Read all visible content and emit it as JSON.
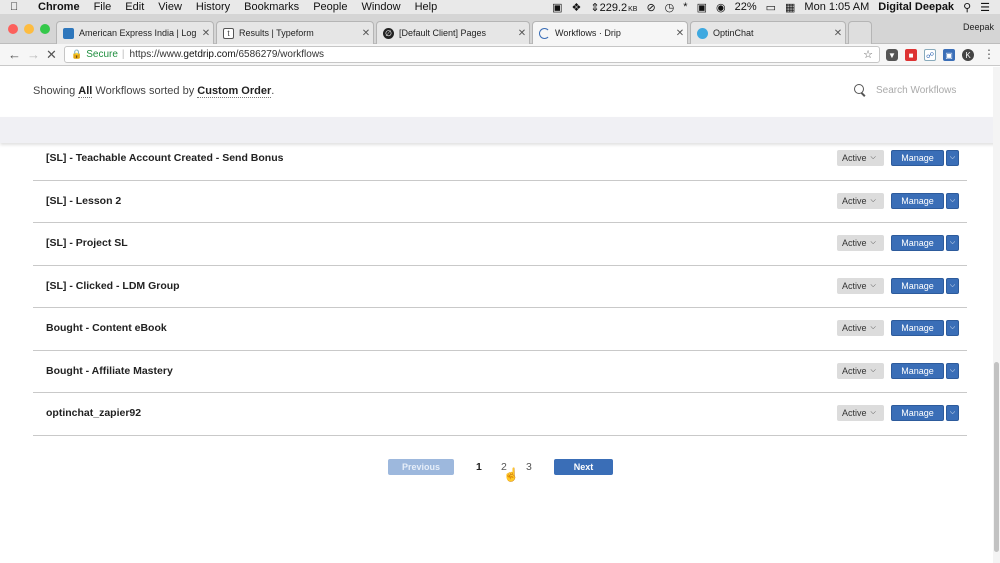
{
  "menubar": {
    "app": "Chrome",
    "items": [
      "File",
      "Edit",
      "View",
      "History",
      "Bookmarks",
      "People",
      "Window",
      "Help"
    ],
    "status": {
      "network": "229.2",
      "network_unit": "KB",
      "battery": "22%",
      "clock": "Mon 1:05 AM",
      "user": "Digital Deepak"
    }
  },
  "tabs": [
    {
      "title": "American Express India | Log i",
      "favicon_color": "#2e77bc"
    },
    {
      "title": "Results | Typeform",
      "favicon_color": "#555555"
    },
    {
      "title": "[Default Client] Pages",
      "favicon_color": "#222222"
    },
    {
      "title": "Workflows · Drip",
      "favicon_color": "#3a6eb7"
    },
    {
      "title": "OptinChat",
      "favicon_color": "#3fa9e0"
    }
  ],
  "profile_name": "Deepak",
  "address_bar": {
    "secure_label": "Secure",
    "url_prefix": "https://www.",
    "url_host": "getdrip.com",
    "url_path": "/6586279/workflows"
  },
  "header": {
    "showing_prefix": "Showing",
    "filter_value": "All",
    "showing_mid": "Workflows sorted by",
    "sort_value": "Custom Order",
    "showing_suffix": ".",
    "search_placeholder": "Search Workflows"
  },
  "workflows": [
    {
      "name": "[SL] - Teachable Account Created - Send Bonus",
      "status": "Active",
      "action": "Manage"
    },
    {
      "name": "[SL] - Lesson 2",
      "status": "Active",
      "action": "Manage"
    },
    {
      "name": "[SL] - Project SL",
      "status": "Active",
      "action": "Manage"
    },
    {
      "name": "[SL] - Clicked - LDM Group",
      "status": "Active",
      "action": "Manage"
    },
    {
      "name": "Bought - Content eBook",
      "status": "Active",
      "action": "Manage"
    },
    {
      "name": "Bought - Affiliate Mastery",
      "status": "Active",
      "action": "Manage"
    },
    {
      "name": "optinchat_zapier92",
      "status": "Active",
      "action": "Manage"
    }
  ],
  "pagination": {
    "previous": "Previous",
    "pages": [
      "1",
      "2",
      "3"
    ],
    "current": "1",
    "next": "Next"
  },
  "colors": {
    "primary": "#3a6eb7",
    "primary_disabled": "#9db8dd",
    "status_bg": "#dcdcdc"
  }
}
